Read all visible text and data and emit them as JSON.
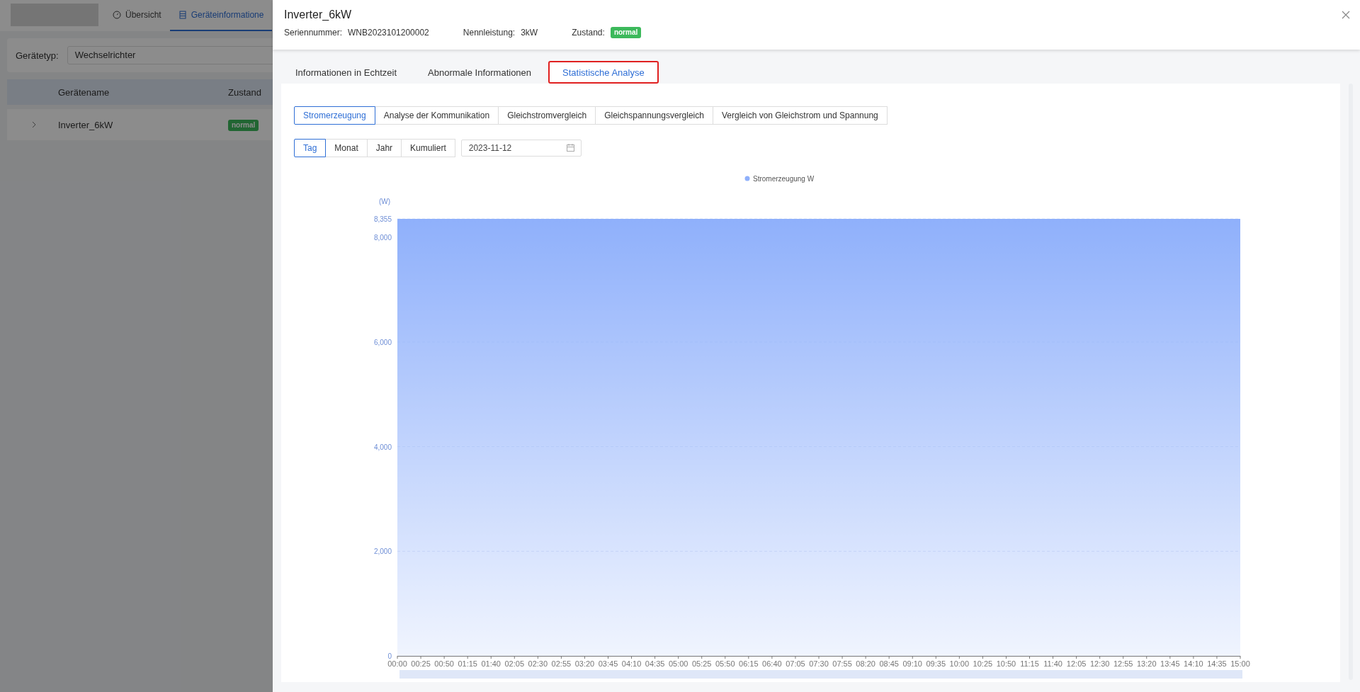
{
  "background_page": {
    "nav": [
      {
        "label": "Übersicht",
        "selected": false
      },
      {
        "label": "Geräteinformatione",
        "selected": true
      }
    ],
    "filter": {
      "label": "Gerätetyp:",
      "value": "Wechselrichter"
    },
    "table": {
      "columns": [
        "Gerätename",
        "Zustand"
      ],
      "rows": [
        {
          "name": "Inverter_6kW",
          "status": "normal",
          "expanded": false
        }
      ]
    }
  },
  "drawer": {
    "title": "Inverter_6kW",
    "info": [
      {
        "label": "Seriennummer:",
        "value": "WNB2023101200002",
        "kind": "text"
      },
      {
        "label": "Nennleistung:",
        "value": "3kW",
        "kind": "text"
      },
      {
        "label": "Zustand:",
        "value": "normal",
        "kind": "badge"
      }
    ],
    "tabs": [
      {
        "label": "Informationen in Echtzeit",
        "selected": false
      },
      {
        "label": "Abnormale Informationen",
        "selected": false
      },
      {
        "label": "Statistische Analyse",
        "selected": true
      }
    ],
    "analysis_tabs": [
      {
        "label": "Stromerzeugung",
        "selected": true
      },
      {
        "label": "Analyse der Kommunikation",
        "selected": false
      },
      {
        "label": "Gleichstromvergleich",
        "selected": false
      },
      {
        "label": "Gleichspannungsvergleich",
        "selected": false
      },
      {
        "label": "Vergleich von Gleichstrom und Spannung",
        "selected": false
      }
    ],
    "period_tabs": [
      {
        "label": "Tag",
        "selected": true
      },
      {
        "label": "Monat",
        "selected": false
      },
      {
        "label": "Jahr",
        "selected": false
      },
      {
        "label": "Kumuliert",
        "selected": false
      }
    ],
    "date": {
      "value": "2023-11-12"
    },
    "chart_data": {
      "type": "area",
      "ylabel": "(W)",
      "categories": [
        "00:00",
        "00:25",
        "00:50",
        "01:15",
        "01:40",
        "02:05",
        "02:30",
        "02:55",
        "03:20",
        "03:45",
        "04:10",
        "04:35",
        "05:00",
        "05:25",
        "05:50",
        "06:15",
        "06:40",
        "07:05",
        "07:30",
        "07:55",
        "08:20",
        "08:45",
        "09:10",
        "09:35",
        "10:00",
        "10:25",
        "10:50",
        "11:15",
        "11:40",
        "12:05",
        "12:30",
        "12:55",
        "13:20",
        "13:45",
        "14:10",
        "14:35",
        "15:00"
      ],
      "series": [
        {
          "name": "Stromerzeugung W",
          "color": "#8fb0fb",
          "values": [
            8355,
            8355,
            8355,
            8355,
            8355,
            8355,
            8355,
            8355,
            8355,
            8355,
            8355,
            8355,
            8355,
            8355,
            8355,
            8355,
            8355,
            8355,
            8355,
            8355,
            8355,
            8355,
            8355,
            8355,
            8355,
            8355,
            8355,
            8355,
            8355,
            8355,
            8355,
            8355,
            8355,
            8355,
            8355,
            8355,
            8355
          ]
        }
      ],
      "ylim": [
        0,
        8355
      ],
      "yticks": [
        0,
        {
          "value": 2000,
          "label": "2,000"
        },
        {
          "value": 4000,
          "label": "4,000"
        },
        {
          "value": 6000,
          "label": "6,000"
        },
        {
          "value": 8000,
          "label": "8,000"
        },
        {
          "value": 8355,
          "label": "8,355"
        }
      ]
    }
  }
}
